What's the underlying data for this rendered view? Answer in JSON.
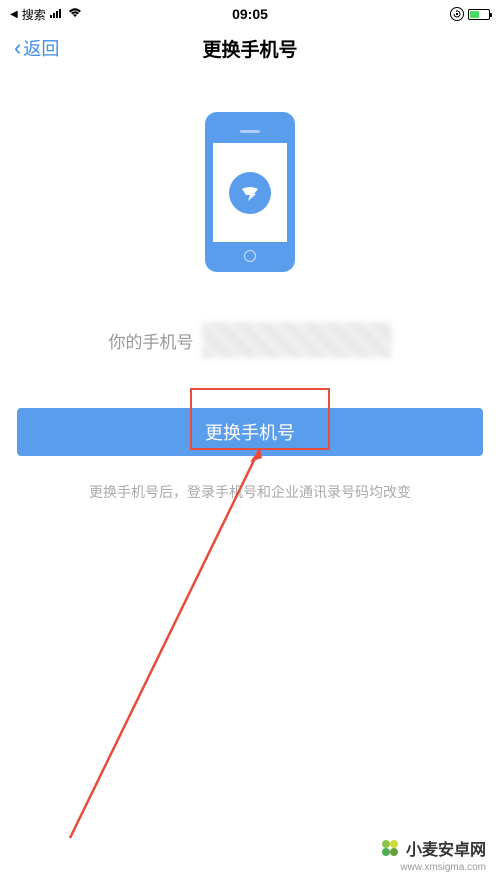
{
  "status_bar": {
    "back_app": "搜索",
    "time": "09:05"
  },
  "nav": {
    "back_label": "返回",
    "title": "更换手机号"
  },
  "content": {
    "phone_label": "你的手机号",
    "change_button": "更换手机号",
    "hint": "更换手机号后，登录手机号和企业通讯录号码均改变"
  },
  "watermark": {
    "name": "小麦安卓网",
    "url": "www.xmsigma.com"
  }
}
